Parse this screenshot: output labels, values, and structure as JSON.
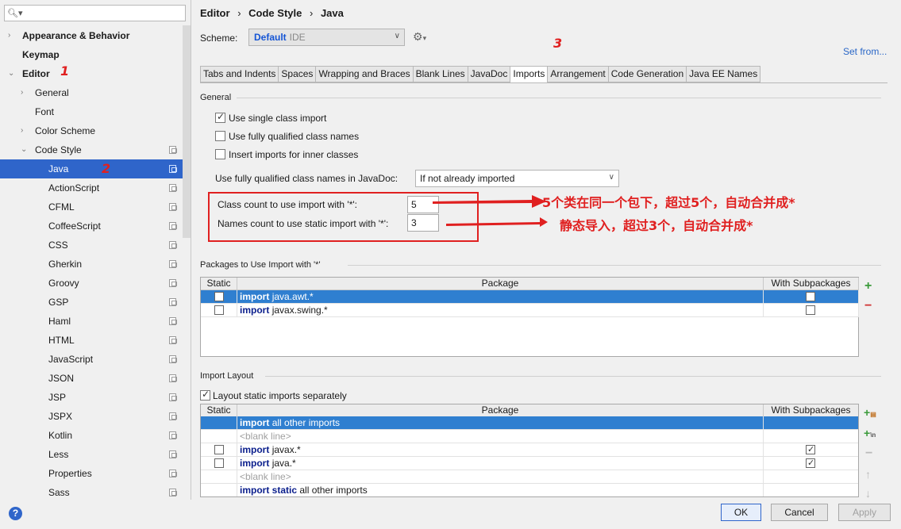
{
  "search": {
    "placeholder": ""
  },
  "tree": [
    {
      "label": "Appearance & Behavior",
      "level": 0,
      "arrow": "›",
      "bold": true
    },
    {
      "label": "Keymap",
      "level": 0,
      "arrow": "",
      "bold": true
    },
    {
      "label": "Editor",
      "level": 0,
      "arrow": "⌄",
      "bold": true
    },
    {
      "label": "General",
      "level": 1,
      "arrow": "›"
    },
    {
      "label": "Font",
      "level": 1,
      "arrow": ""
    },
    {
      "label": "Color Scheme",
      "level": 1,
      "arrow": "›"
    },
    {
      "label": "Code Style",
      "level": 1,
      "arrow": "⌄",
      "copy": true
    },
    {
      "label": "Java",
      "level": 2,
      "selected": true,
      "copy": true
    },
    {
      "label": "ActionScript",
      "level": 2,
      "copy": true
    },
    {
      "label": "CFML",
      "level": 2,
      "copy": true
    },
    {
      "label": "CoffeeScript",
      "level": 2,
      "copy": true
    },
    {
      "label": "CSS",
      "level": 2,
      "copy": true
    },
    {
      "label": "Gherkin",
      "level": 2,
      "copy": true
    },
    {
      "label": "Groovy",
      "level": 2,
      "copy": true
    },
    {
      "label": "GSP",
      "level": 2,
      "copy": true
    },
    {
      "label": "Haml",
      "level": 2,
      "copy": true
    },
    {
      "label": "HTML",
      "level": 2,
      "copy": true
    },
    {
      "label": "JavaScript",
      "level": 2,
      "copy": true
    },
    {
      "label": "JSON",
      "level": 2,
      "copy": true
    },
    {
      "label": "JSP",
      "level": 2,
      "copy": true
    },
    {
      "label": "JSPX",
      "level": 2,
      "copy": true
    },
    {
      "label": "Kotlin",
      "level": 2,
      "copy": true
    },
    {
      "label": "Less",
      "level": 2,
      "copy": true
    },
    {
      "label": "Properties",
      "level": 2,
      "copy": true
    },
    {
      "label": "Sass",
      "level": 2,
      "copy": true
    }
  ],
  "annotations": {
    "n1": "1",
    "n2": "2",
    "n3": "3",
    "note1": "5个类在同一个包下，超过5个，自动合并成*",
    "note2": "静态导入，超过3个，自动合并成*"
  },
  "breadcrumb": [
    "Editor",
    "›",
    "Code Style",
    "›",
    "Java"
  ],
  "scheme": {
    "label": "Scheme:",
    "name": "Default",
    "type": "IDE"
  },
  "set_from": "Set from...",
  "tabs": [
    "Tabs and Indents",
    "Spaces",
    "Wrapping and Braces",
    "Blank Lines",
    "JavaDoc",
    "Imports",
    "Arrangement",
    "Code Generation",
    "Java EE Names"
  ],
  "active_tab": "Imports",
  "general": {
    "title": "General",
    "use_single": "Use single class import",
    "use_fq": "Use fully qualified class names",
    "insert_inner": "Insert imports for inner classes",
    "javadoc_label": "Use fully qualified class names in JavaDoc:",
    "javadoc_value": "If not already imported",
    "class_count_label": "Class count to use import with '*':",
    "class_count": "5",
    "names_count_label": "Names count to use static import with '*':",
    "names_count": "3"
  },
  "packages": {
    "title": "Packages to Use Import with '*'",
    "headers": [
      "Static",
      "Package",
      "With Subpackages"
    ],
    "rows": [
      {
        "kw": "import",
        "text": "java.awt.*",
        "selected": true
      },
      {
        "kw": "import",
        "text": "javax.swing.*",
        "selected": false
      }
    ]
  },
  "layout": {
    "title": "Import Layout",
    "separate": "Layout static imports separately",
    "headers": [
      "Static",
      "Package",
      "With Subpackages"
    ],
    "rows": [
      {
        "kw": "import",
        "text": "all other imports",
        "selected": true,
        "static_cb": false,
        "sub_cb": false
      },
      {
        "kw": "",
        "text": "<blank line>",
        "blank": true
      },
      {
        "kw": "import",
        "text": "javax.*",
        "static_cb": true,
        "sub_cb": true,
        "sub_on": true
      },
      {
        "kw": "import",
        "text": "java.*",
        "static_cb": true,
        "sub_cb": true,
        "sub_on": true
      },
      {
        "kw": "",
        "text": "<blank line>",
        "blank": true
      },
      {
        "kw": "import static",
        "text": "all other imports"
      }
    ]
  },
  "buttons": {
    "ok": "OK",
    "cancel": "Cancel",
    "apply": "Apply",
    "help": "?"
  }
}
